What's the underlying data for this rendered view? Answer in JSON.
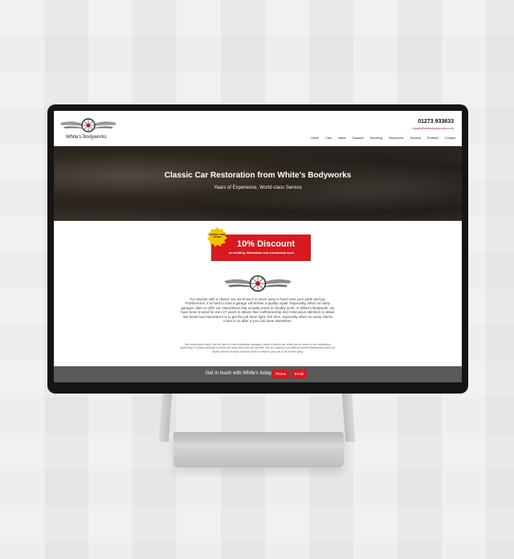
{
  "site": {
    "brand": "White's Bodyworks",
    "phone": "01273 933633",
    "email": "repairs@whitesbodyworks.co.uk"
  },
  "nav": [
    "Home",
    "Cars",
    "Bikes",
    "Classics",
    "Servicing",
    "Resources",
    "General",
    "Portfolio",
    "Contact"
  ],
  "hero": {
    "title": "Classic Car Restoration from White's Bodyworks",
    "subtitle": "Years of Experience, World-class Service"
  },
  "promo": {
    "badge": "LIMITED TIME OFFER",
    "headline": "10% Discount",
    "detail": "on welding, fabrication and mechanical work"
  },
  "body": {
    "paragraph1": "For anyone with a classic car, we know it is never easy to hand over your pride and joy. Furthermore, it is hard to trust a garage will deliver a quality repair. Especially, when so many garages claim to offer car restorations that actually result in shoddy work. At White's Bodywork, we have been trusted for over 27 years to deliver fine craftsmanship and meticulous attention to detail. We know how important it is to get the job done right, first time, especially when so many clients come to us after a poor job done elsewhere.",
    "paragraph2": "We understand that it can be hard to trust restoration garages, which is which we invite you to come to our restoration workshop in Sussex and get to know the team and how we operate. We are happy to provide an honest assessment and our expert advice of what could be done to restore your car to its former glory."
  },
  "footer": {
    "cta": "Get in touch with White's today",
    "phone_button": "Phone",
    "email_button": "Email"
  },
  "colors": {
    "accent": "#d71920",
    "badge": "#f4c400",
    "footer": "#5a5a5a",
    "bezel": "#151515"
  },
  "icons": {
    "logo": "winged-wheel-logo"
  }
}
